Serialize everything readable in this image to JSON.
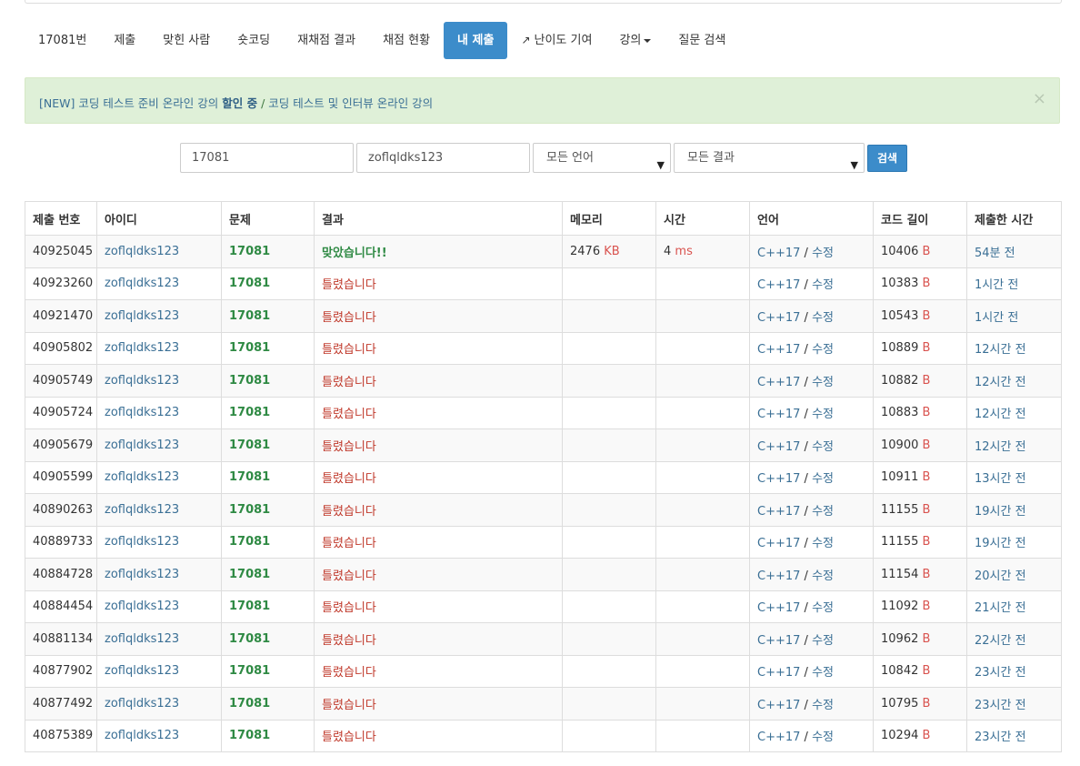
{
  "nav": {
    "items": [
      {
        "label": "17081번",
        "name": "tab-problem",
        "active": false
      },
      {
        "label": "제출",
        "name": "tab-submit",
        "active": false
      },
      {
        "label": "맞힌 사람",
        "name": "tab-solvers",
        "active": false
      },
      {
        "label": "숏코딩",
        "name": "tab-shortcoding",
        "active": false
      },
      {
        "label": "재채점 결과",
        "name": "tab-rejudge",
        "active": false
      },
      {
        "label": "채점 현황",
        "name": "tab-status",
        "active": false
      },
      {
        "label": "내 제출",
        "name": "tab-my-submissions",
        "active": true
      },
      {
        "label": "난이도 기여",
        "name": "tab-difficulty",
        "active": false,
        "icon": "external-link-icon"
      },
      {
        "label": "강의",
        "name": "tab-lectures",
        "active": false,
        "dropdown": true
      },
      {
        "label": "질문 검색",
        "name": "tab-question-search",
        "active": false
      }
    ]
  },
  "alert": {
    "new_tag": "[NEW]",
    "text1": "코딩 테스트 준비 온라인 강의",
    "highlight": "할인 중",
    "separator": "/",
    "text2": "코딩 테스트 및 인터뷰 온라인 강의",
    "close": "×"
  },
  "search": {
    "problem_id": "17081",
    "user_id": "zoflqldks123",
    "language": "모든 언어",
    "result": "모든 결과",
    "button": "검색"
  },
  "table": {
    "headers": [
      "제출 번호",
      "아이디",
      "문제",
      "결과",
      "메모리",
      "시간",
      "언어",
      "코드 길이",
      "제출한 시간"
    ],
    "rows": [
      {
        "id": "40925045",
        "user": "zoflqldks123",
        "problem": "17081",
        "result": "맞았습니다!!",
        "accepted": true,
        "memory": "2476",
        "memory_unit": "KB",
        "time": "4",
        "time_unit": "ms",
        "lang": "C++17",
        "edit": "수정",
        "length": "10406",
        "length_unit": "B",
        "submitted": "54분 전"
      },
      {
        "id": "40923260",
        "user": "zoflqldks123",
        "problem": "17081",
        "result": "틀렸습니다",
        "accepted": false,
        "memory": "",
        "memory_unit": "",
        "time": "",
        "time_unit": "",
        "lang": "C++17",
        "edit": "수정",
        "length": "10383",
        "length_unit": "B",
        "submitted": "1시간 전"
      },
      {
        "id": "40921470",
        "user": "zoflqldks123",
        "problem": "17081",
        "result": "틀렸습니다",
        "accepted": false,
        "memory": "",
        "memory_unit": "",
        "time": "",
        "time_unit": "",
        "lang": "C++17",
        "edit": "수정",
        "length": "10543",
        "length_unit": "B",
        "submitted": "1시간 전"
      },
      {
        "id": "40905802",
        "user": "zoflqldks123",
        "problem": "17081",
        "result": "틀렸습니다",
        "accepted": false,
        "memory": "",
        "memory_unit": "",
        "time": "",
        "time_unit": "",
        "lang": "C++17",
        "edit": "수정",
        "length": "10889",
        "length_unit": "B",
        "submitted": "12시간 전"
      },
      {
        "id": "40905749",
        "user": "zoflqldks123",
        "problem": "17081",
        "result": "틀렸습니다",
        "accepted": false,
        "memory": "",
        "memory_unit": "",
        "time": "",
        "time_unit": "",
        "lang": "C++17",
        "edit": "수정",
        "length": "10882",
        "length_unit": "B",
        "submitted": "12시간 전"
      },
      {
        "id": "40905724",
        "user": "zoflqldks123",
        "problem": "17081",
        "result": "틀렸습니다",
        "accepted": false,
        "memory": "",
        "memory_unit": "",
        "time": "",
        "time_unit": "",
        "lang": "C++17",
        "edit": "수정",
        "length": "10883",
        "length_unit": "B",
        "submitted": "12시간 전"
      },
      {
        "id": "40905679",
        "user": "zoflqldks123",
        "problem": "17081",
        "result": "틀렸습니다",
        "accepted": false,
        "memory": "",
        "memory_unit": "",
        "time": "",
        "time_unit": "",
        "lang": "C++17",
        "edit": "수정",
        "length": "10900",
        "length_unit": "B",
        "submitted": "12시간 전"
      },
      {
        "id": "40905599",
        "user": "zoflqldks123",
        "problem": "17081",
        "result": "틀렸습니다",
        "accepted": false,
        "memory": "",
        "memory_unit": "",
        "time": "",
        "time_unit": "",
        "lang": "C++17",
        "edit": "수정",
        "length": "10911",
        "length_unit": "B",
        "submitted": "13시간 전"
      },
      {
        "id": "40890263",
        "user": "zoflqldks123",
        "problem": "17081",
        "result": "틀렸습니다",
        "accepted": false,
        "memory": "",
        "memory_unit": "",
        "time": "",
        "time_unit": "",
        "lang": "C++17",
        "edit": "수정",
        "length": "11155",
        "length_unit": "B",
        "submitted": "19시간 전"
      },
      {
        "id": "40889733",
        "user": "zoflqldks123",
        "problem": "17081",
        "result": "틀렸습니다",
        "accepted": false,
        "memory": "",
        "memory_unit": "",
        "time": "",
        "time_unit": "",
        "lang": "C++17",
        "edit": "수정",
        "length": "11155",
        "length_unit": "B",
        "submitted": "19시간 전"
      },
      {
        "id": "40884728",
        "user": "zoflqldks123",
        "problem": "17081",
        "result": "틀렸습니다",
        "accepted": false,
        "memory": "",
        "memory_unit": "",
        "time": "",
        "time_unit": "",
        "lang": "C++17",
        "edit": "수정",
        "length": "11154",
        "length_unit": "B",
        "submitted": "20시간 전"
      },
      {
        "id": "40884454",
        "user": "zoflqldks123",
        "problem": "17081",
        "result": "틀렸습니다",
        "accepted": false,
        "memory": "",
        "memory_unit": "",
        "time": "",
        "time_unit": "",
        "lang": "C++17",
        "edit": "수정",
        "length": "11092",
        "length_unit": "B",
        "submitted": "21시간 전"
      },
      {
        "id": "40881134",
        "user": "zoflqldks123",
        "problem": "17081",
        "result": "틀렸습니다",
        "accepted": false,
        "memory": "",
        "memory_unit": "",
        "time": "",
        "time_unit": "",
        "lang": "C++17",
        "edit": "수정",
        "length": "10962",
        "length_unit": "B",
        "submitted": "22시간 전"
      },
      {
        "id": "40877902",
        "user": "zoflqldks123",
        "problem": "17081",
        "result": "틀렸습니다",
        "accepted": false,
        "memory": "",
        "memory_unit": "",
        "time": "",
        "time_unit": "",
        "lang": "C++17",
        "edit": "수정",
        "length": "10842",
        "length_unit": "B",
        "submitted": "23시간 전"
      },
      {
        "id": "40877492",
        "user": "zoflqldks123",
        "problem": "17081",
        "result": "틀렸습니다",
        "accepted": false,
        "memory": "",
        "memory_unit": "",
        "time": "",
        "time_unit": "",
        "lang": "C++17",
        "edit": "수정",
        "length": "10795",
        "length_unit": "B",
        "submitted": "23시간 전"
      },
      {
        "id": "40875389",
        "user": "zoflqldks123",
        "problem": "17081",
        "result": "틀렸습니다",
        "accepted": false,
        "memory": "",
        "memory_unit": "",
        "time": "",
        "time_unit": "",
        "lang": "C++17",
        "edit": "수정",
        "length": "10294",
        "length_unit": "B",
        "submitted": "23시간 전"
      }
    ]
  },
  "colors": {
    "primary": "#3c8cca",
    "accepted": "#2f8a44",
    "wrong": "#c0392b",
    "link": "#3a6f95",
    "alert_bg": "#dff0d8"
  }
}
